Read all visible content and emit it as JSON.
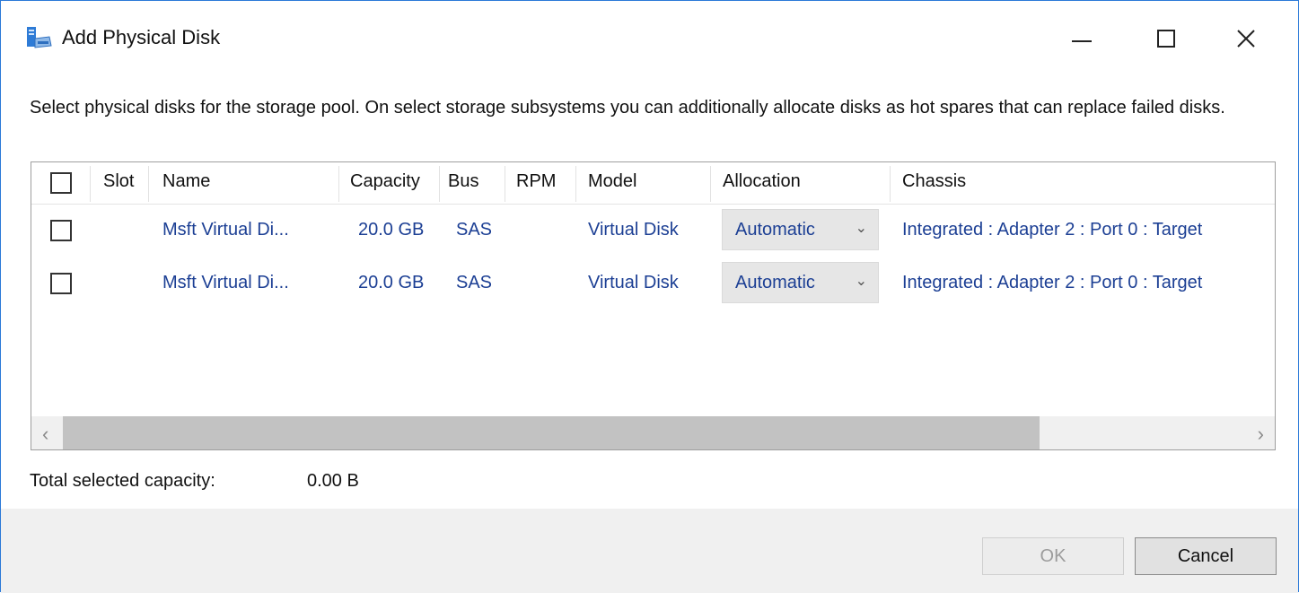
{
  "window": {
    "title": "Add Physical Disk",
    "icon": "storage-pool-icon",
    "controls": {
      "minimize": "minimize-icon",
      "maximize": "maximize-icon",
      "close": "close-icon"
    }
  },
  "description": "Select physical disks for the storage pool. On select storage subsystems you can additionally allocate disks as hot spares that can replace failed disks.",
  "table": {
    "columns": [
      "Slot",
      "Name",
      "Capacity",
      "Bus",
      "RPM",
      "Model",
      "Allocation",
      "Chassis"
    ],
    "rows": [
      {
        "checked": false,
        "slot": "",
        "name": "Msft Virtual Di...",
        "capacity": "20.0 GB",
        "bus": "SAS",
        "rpm": "",
        "model": "Virtual Disk",
        "allocation": "Automatic",
        "chassis": "Integrated : Adapter 2 : Port 0 : Target"
      },
      {
        "checked": false,
        "slot": "",
        "name": "Msft Virtual Di...",
        "capacity": "20.0 GB",
        "bus": "SAS",
        "rpm": "",
        "model": "Virtual Disk",
        "allocation": "Automatic",
        "chassis": "Integrated : Adapter 2 : Port 0 : Target"
      }
    ]
  },
  "totals": {
    "label": "Total selected capacity:",
    "value": "0.00 B"
  },
  "buttons": {
    "ok": "OK",
    "cancel": "Cancel"
  },
  "colors": {
    "link_text": "#1c3f94",
    "window_border": "#2b79d8",
    "footer_bg": "#f0f0f0"
  }
}
